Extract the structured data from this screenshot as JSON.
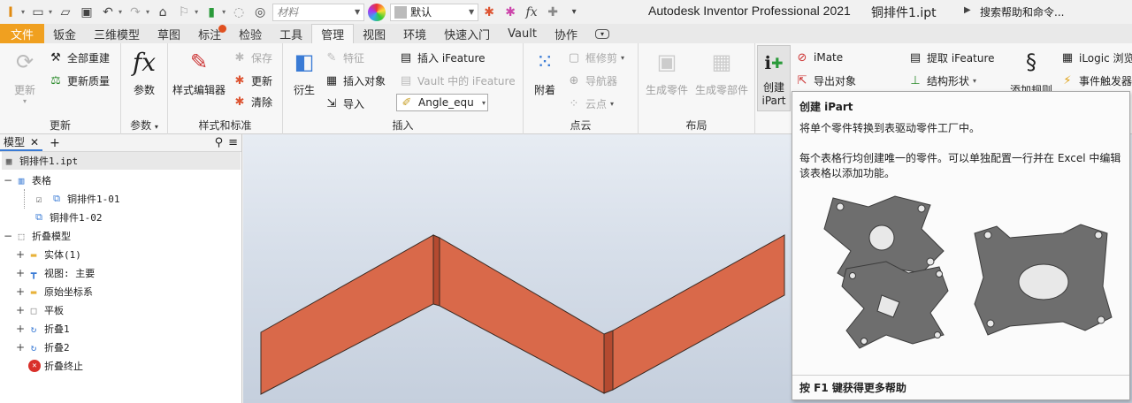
{
  "quick_access": {
    "material_placeholder": "材料",
    "appearance_value": "默认",
    "app_title": "Autodesk Inventor Professional 2021",
    "file_name": "铜排件1.ipt",
    "help_search": "搜索帮助和命令..."
  },
  "tabs": [
    {
      "label": "文件"
    },
    {
      "label": "钣金"
    },
    {
      "label": "三维模型"
    },
    {
      "label": "草图"
    },
    {
      "label": "标注"
    },
    {
      "label": "检验"
    },
    {
      "label": "工具"
    },
    {
      "label": "管理"
    },
    {
      "label": "视图"
    },
    {
      "label": "环境"
    },
    {
      "label": "快速入门"
    },
    {
      "label": "Vault"
    },
    {
      "label": "协作"
    }
  ],
  "ribbon": {
    "update": {
      "update_label": "更新",
      "rebuild_all": "全部重建",
      "update_mass": "更新质量",
      "title": "更新"
    },
    "params": {
      "params_label": "参数",
      "title": "参数"
    },
    "styles": {
      "style_editor": "样式编辑器",
      "save": "保存",
      "update": "更新",
      "purge": "清除",
      "title": "样式和标准"
    },
    "insert": {
      "derive": "衍生",
      "feature": "特征",
      "insert_object": "插入对象",
      "import": "导入",
      "insert_ifeature": "插入 iFeature",
      "vault_ifeature": "Vault 中的 iFeature",
      "angle_combo": "Angle_equ",
      "title": "插入"
    },
    "pointcloud": {
      "attach": "附着",
      "frame_trim": "框修剪",
      "navigator": "导航器",
      "cloud_point": "云点",
      "title": "点云"
    },
    "layout": {
      "make_part": "生成零件",
      "make_components": "生成零部件",
      "title": "布局"
    },
    "author": {
      "create_ipart": "创建 iPart",
      "imate": "iMate",
      "export_object": "导出对象",
      "extract_ifeature": "提取 iFeature",
      "structural_shape": "结构形状",
      "add_rule": "添加规则",
      "ilogic_browser": "iLogic 浏览",
      "event_trigger": "事件触发器"
    }
  },
  "browser": {
    "tab_label": "模型",
    "root": "铜排件1.ipt",
    "items": [
      {
        "label": "表格"
      },
      {
        "label": "铜排件1-01"
      },
      {
        "label": "铜排件1-02"
      },
      {
        "label": "折叠模型"
      },
      {
        "label": "实体(1)"
      },
      {
        "label": "视图: 主要"
      },
      {
        "label": "原始坐标系"
      },
      {
        "label": "平板"
      },
      {
        "label": "折叠1"
      },
      {
        "label": "折叠2"
      },
      {
        "label": "折叠终止"
      }
    ]
  },
  "tooltip": {
    "title": "创建 iPart",
    "description": "将单个零件转换到表驱动零件工厂中。",
    "detail": "每个表格行均创建唯一的零件。可以单独配置一行并在 Excel 中编辑该表格以添加功能。",
    "footer": "按 F1 键获得更多帮助"
  },
  "colors": {
    "file_tab": "#f0a020",
    "part_color": "#d9694a",
    "part_edge": "#3a2a22"
  }
}
